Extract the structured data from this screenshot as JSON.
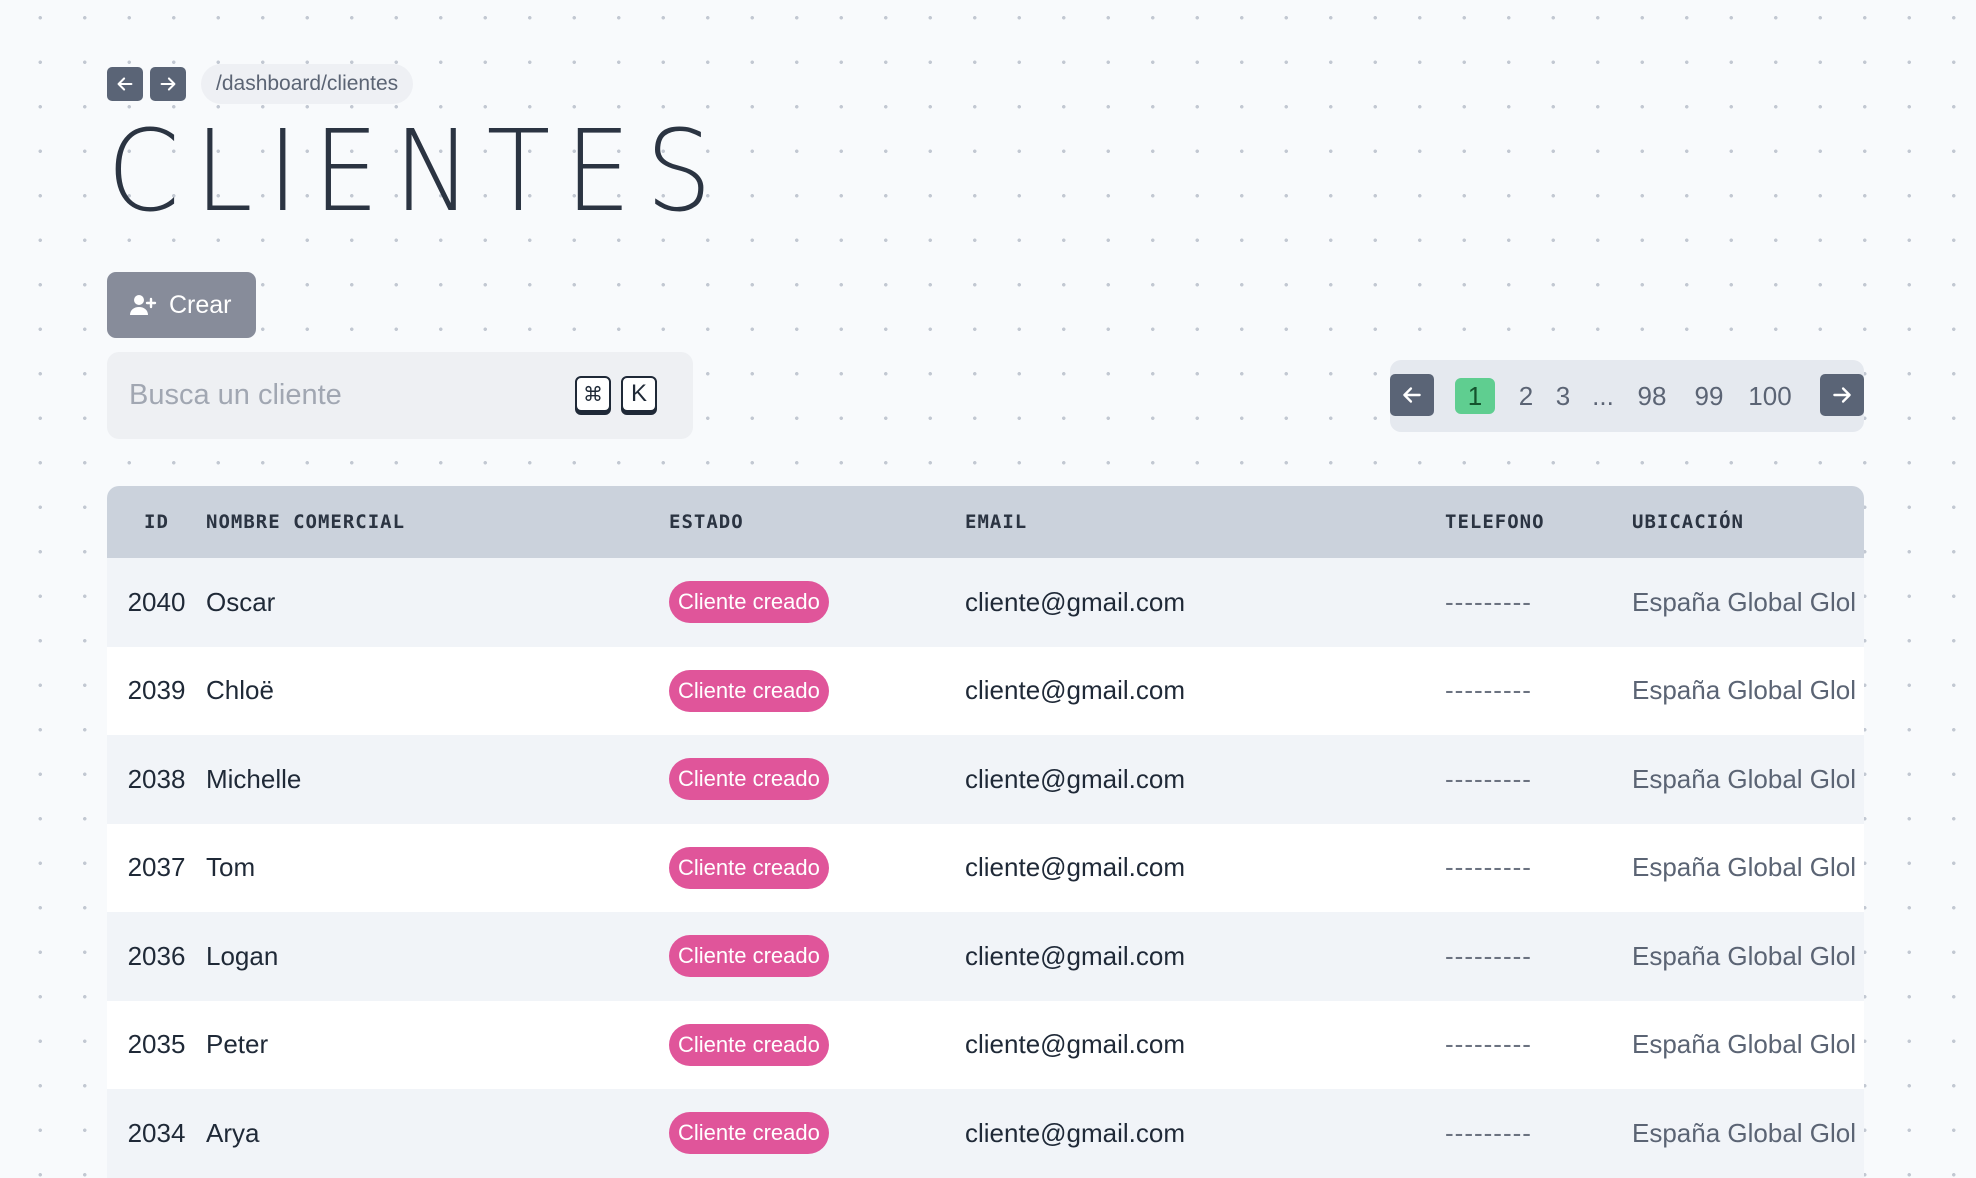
{
  "nav": {
    "back_icon": "arrow-left-icon",
    "forward_icon": "arrow-right-icon",
    "breadcrumb": "/dashboard/clientes"
  },
  "page_title": "CLIENTES",
  "create_button": {
    "label": "Crear",
    "icon": "user-plus-icon"
  },
  "search": {
    "placeholder": "Busca un cliente",
    "value": "",
    "shortcut_cmd": "⌘",
    "shortcut_key": "K"
  },
  "pagination": {
    "pages": [
      "1",
      "2",
      "3",
      "...",
      "98",
      "99",
      "100"
    ],
    "current": "1"
  },
  "table": {
    "headers": {
      "id": "ID",
      "name": "NOMBRE COMERCIAL",
      "state": "ESTADO",
      "email": "EMAIL",
      "phone": "TELEFONO",
      "location": "UBICACIÓN"
    },
    "rows": [
      {
        "id": "2040",
        "name": "Oscar",
        "state": "Cliente creado",
        "email": "cliente@gmail.com",
        "phone": "---------",
        "location": "España Global Glol"
      },
      {
        "id": "2039",
        "name": "Chloë",
        "state": "Cliente creado",
        "email": "cliente@gmail.com",
        "phone": "---------",
        "location": "España Global Glol"
      },
      {
        "id": "2038",
        "name": "Michelle",
        "state": "Cliente creado",
        "email": "cliente@gmail.com",
        "phone": "---------",
        "location": "España Global Glol"
      },
      {
        "id": "2037",
        "name": "Tom",
        "state": "Cliente creado",
        "email": "cliente@gmail.com",
        "phone": "---------",
        "location": "España Global Glol"
      },
      {
        "id": "2036",
        "name": "Logan",
        "state": "Cliente creado",
        "email": "cliente@gmail.com",
        "phone": "---------",
        "location": "España Global Glol"
      },
      {
        "id": "2035",
        "name": "Peter",
        "state": "Cliente creado",
        "email": "cliente@gmail.com",
        "phone": "---------",
        "location": "España Global Glol"
      },
      {
        "id": "2034",
        "name": "Arya",
        "state": "Cliente creado",
        "email": "cliente@gmail.com",
        "phone": "---------",
        "location": "España Global Glol"
      }
    ]
  },
  "colors": {
    "status_badge": "#e0559a",
    "active_page": "#5fce90",
    "nav_button": "#5a6476",
    "header_row": "#cbd2dc"
  }
}
